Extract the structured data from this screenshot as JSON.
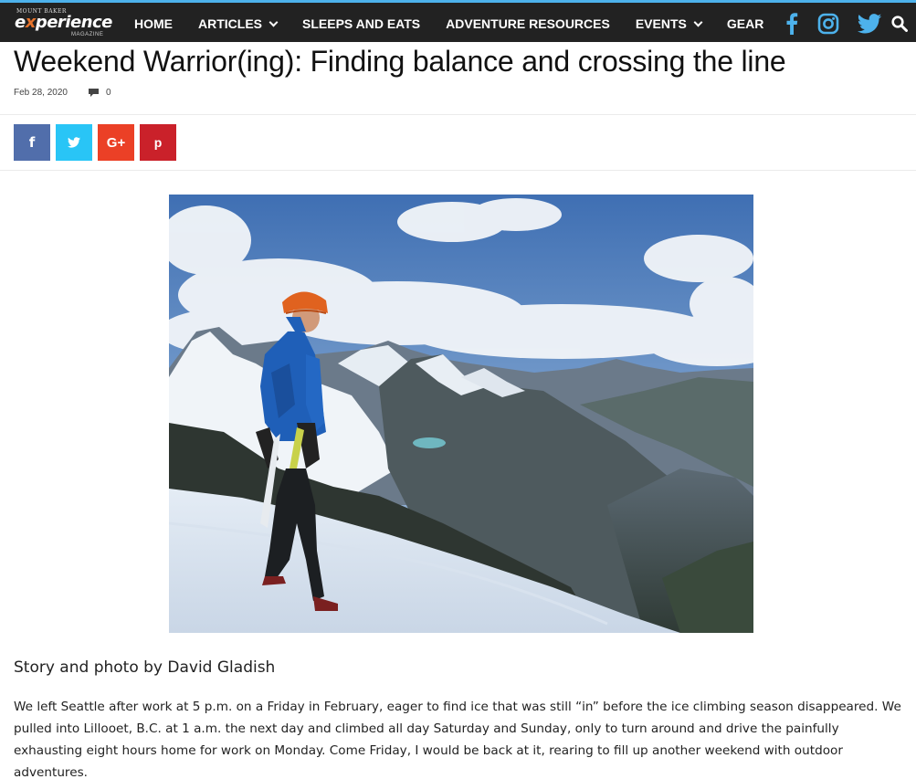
{
  "site": {
    "logo_top": "MOUNT BAKER",
    "logo_main_first": "e",
    "logo_main_x": "x",
    "logo_main_rest": "perience",
    "logo_sub": "MAGAZINE"
  },
  "nav": {
    "items": [
      {
        "label": "HOME",
        "has_dropdown": false
      },
      {
        "label": "ARTICLES",
        "has_dropdown": true
      },
      {
        "label": "SLEEPS AND EATS",
        "has_dropdown": false
      },
      {
        "label": "ADVENTURE RESOURCES",
        "has_dropdown": false
      },
      {
        "label": "EVENTS",
        "has_dropdown": true
      },
      {
        "label": "GEAR",
        "has_dropdown": false
      }
    ],
    "social": [
      "facebook-icon",
      "instagram-icon",
      "twitter-icon",
      "search-icon"
    ]
  },
  "article": {
    "title": "Weekend Warrior(ing): Finding balance and crossing the line",
    "date": "Feb 28, 2020",
    "comment_count": "0",
    "share_buttons": [
      {
        "icon": "facebook-icon",
        "glyph": "f",
        "color": "#516eab"
      },
      {
        "icon": "twitter-icon",
        "glyph": "",
        "color": "#29c5f6"
      },
      {
        "icon": "google-plus-icon",
        "glyph": "G+",
        "color": "#eb4026"
      },
      {
        "icon": "pinterest-icon",
        "glyph": "p",
        "color": "#ca212a"
      }
    ],
    "byline": "Story and photo by David Gladish",
    "paragraph": "We left Seattle after work at 5 p.m. on a Friday in February, eager to find ice that was still “in” before the ice climbing season disappeared. We pulled into Lillooet, B.C. at 1 a.m. the next day and climbed all day Saturday and Sunday, only to turn around and drive the painfully exhausting eight hours home for work on Monday. Come Friday, I would be back at it, rearing to fill up another weekend with outdoor adventures."
  },
  "colors": {
    "nav_bg": "#222222",
    "accent": "#4db2ec",
    "facebook": "#516eab",
    "twitter": "#29c5f6",
    "google_plus": "#eb4026",
    "pinterest": "#ca212a"
  }
}
